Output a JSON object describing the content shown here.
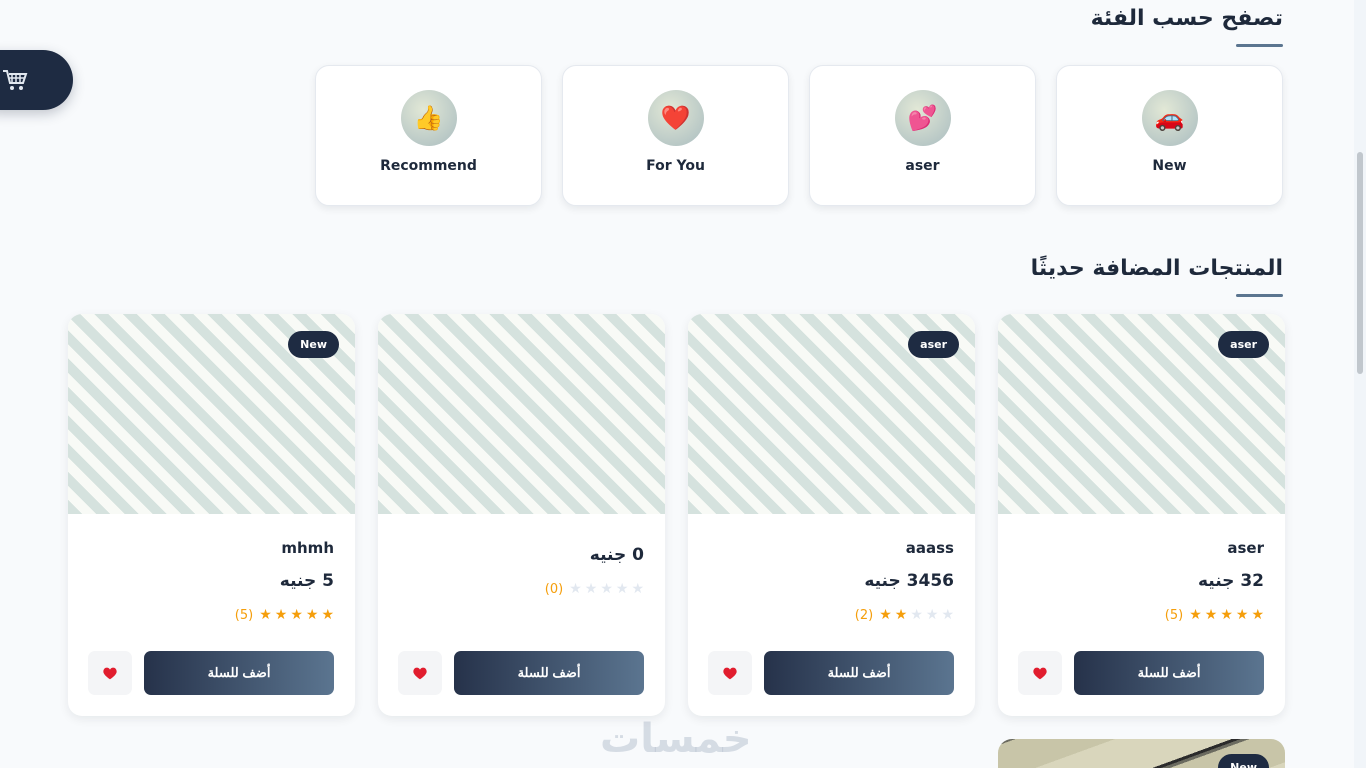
{
  "categories_section": {
    "title": "تصفح حسب الفئة"
  },
  "categories": [
    {
      "label": "New",
      "icon": "car-icon",
      "glyph": "🚗"
    },
    {
      "label": "aser",
      "icon": "hearts-icon",
      "glyph": "💕"
    },
    {
      "label": "For You",
      "icon": "heart-icon",
      "glyph": "❤️"
    },
    {
      "label": "Recommend",
      "icon": "thumbs-up-icon",
      "glyph": "👍"
    }
  ],
  "products_section": {
    "title": "المنتجات المضافة حديثًا"
  },
  "products": [
    {
      "badge": "aser",
      "name": "aser",
      "price": "32 جنيه",
      "rating": 5,
      "rating_count": "(5)",
      "add_label": "أضف للسلة"
    },
    {
      "badge": "aser",
      "name": "aaass",
      "price": "3456 جنيه",
      "rating": 2,
      "rating_count": "(2)",
      "add_label": "أضف للسلة"
    },
    {
      "badge": "",
      "name": "",
      "price": "0 جنيه",
      "rating": 0,
      "rating_count": "(0)",
      "add_label": "أضف للسلة"
    },
    {
      "badge": "New",
      "name": "mhmh",
      "price": "5 جنيه",
      "rating": 5,
      "rating_count": "(5)",
      "add_label": "أضف للسلة"
    }
  ],
  "partial_product": {
    "badge": "New"
  },
  "watermark": "خمسات",
  "colors": {
    "primary": "#1e2b42",
    "accent": "#5b7590",
    "star": "#f59e0b",
    "heart": "#e11d2e"
  }
}
